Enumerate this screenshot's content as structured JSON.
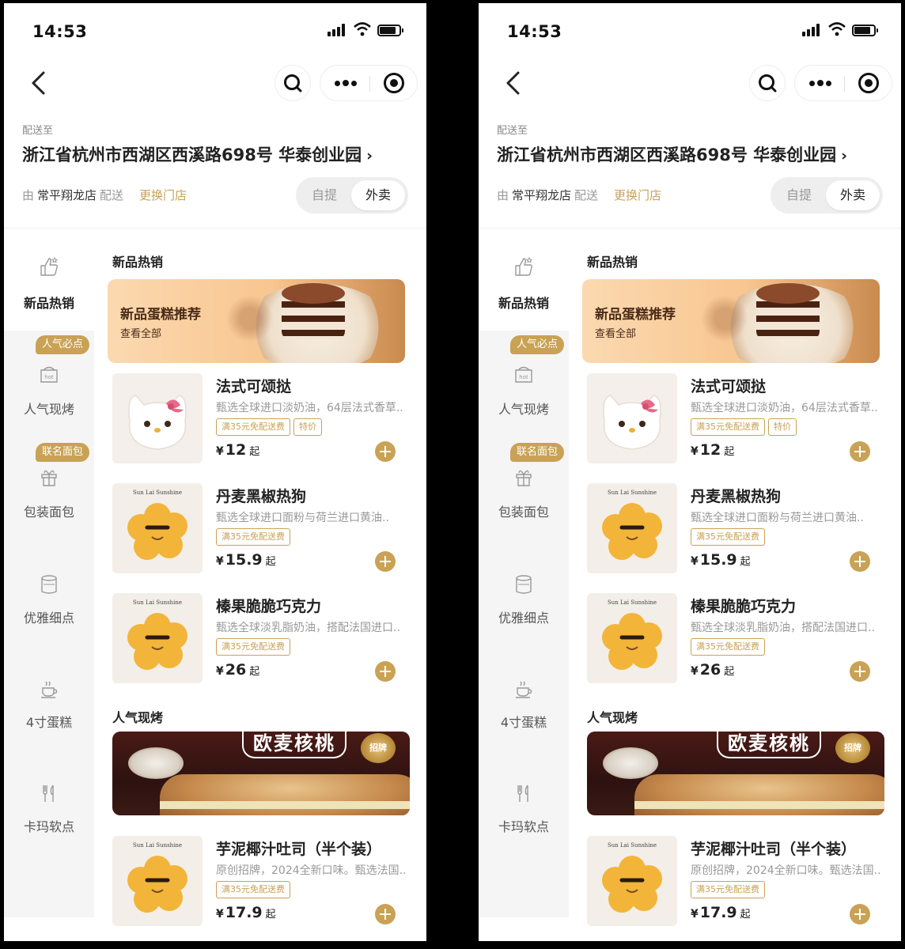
{
  "status": {
    "time": "14:53"
  },
  "address": {
    "deliver_to_label": "配送至",
    "full": "浙江省杭州市西湖区西溪路698号 华泰创业园",
    "chevron": "›"
  },
  "store": {
    "prefix": "由",
    "name": "常平翔龙店",
    "suffix": "配送",
    "switch_label": "更换门店"
  },
  "mode": {
    "pickup": "自提",
    "delivery": "外卖",
    "selected": "外卖"
  },
  "sidebar": {
    "items": [
      {
        "label": "新品热销",
        "icon": "thumbs-up-icon",
        "active": true
      },
      {
        "label": "人气现烤",
        "icon": "hot-box-icon",
        "badge": "人气必点"
      },
      {
        "label": "包装面包",
        "icon": "gift-box-icon",
        "badge": "联名面包"
      },
      {
        "label": "优雅细点",
        "icon": "canister-icon"
      },
      {
        "label": "4寸蛋糕",
        "icon": "coffee-cup-icon"
      },
      {
        "label": "卡玛软点",
        "icon": "utensils-icon"
      }
    ]
  },
  "sections": [
    {
      "title": "新品热销",
      "banner": {
        "title": "新品蛋糕推荐",
        "subtitle": "查看全部"
      },
      "products": [
        {
          "name": "法式可颂挞",
          "desc": "甄选全球进口淡奶油，64层法式香草..",
          "tags": [
            "满35元免配送费",
            "特价"
          ],
          "currency": "¥",
          "price": "12",
          "price_suffix": "起"
        },
        {
          "name": "丹麦黑椒热狗",
          "desc": "甄选全球进口面粉与荷兰进口黄油..",
          "tags": [
            "满35元免配送费"
          ],
          "currency": "¥",
          "price": "15.9",
          "price_suffix": "起"
        },
        {
          "name": "榛果脆脆巧克力",
          "desc": "甄选全球淡乳脂奶油，搭配法国进口..",
          "tags": [
            "满35元免配送费"
          ],
          "currency": "¥",
          "price": "26",
          "price_suffix": "起"
        }
      ]
    },
    {
      "title": "人气现烤",
      "banner": {
        "title": "欧麦核桃",
        "badge": "招牌"
      },
      "products": [
        {
          "name": "芋泥椰汁吐司（半个装）",
          "desc": "原创招牌，2024全新口味。甄选法国..",
          "tags": [
            "满35元免配送费"
          ],
          "currency": "¥",
          "price": "17.9",
          "price_suffix": "起"
        }
      ]
    }
  ],
  "product_image_brand": "Sun Lai Sunshine",
  "colors": {
    "accent": "#c9a255",
    "sidebar_bg": "#f5f5f5",
    "page_bg": "#ffffff"
  }
}
